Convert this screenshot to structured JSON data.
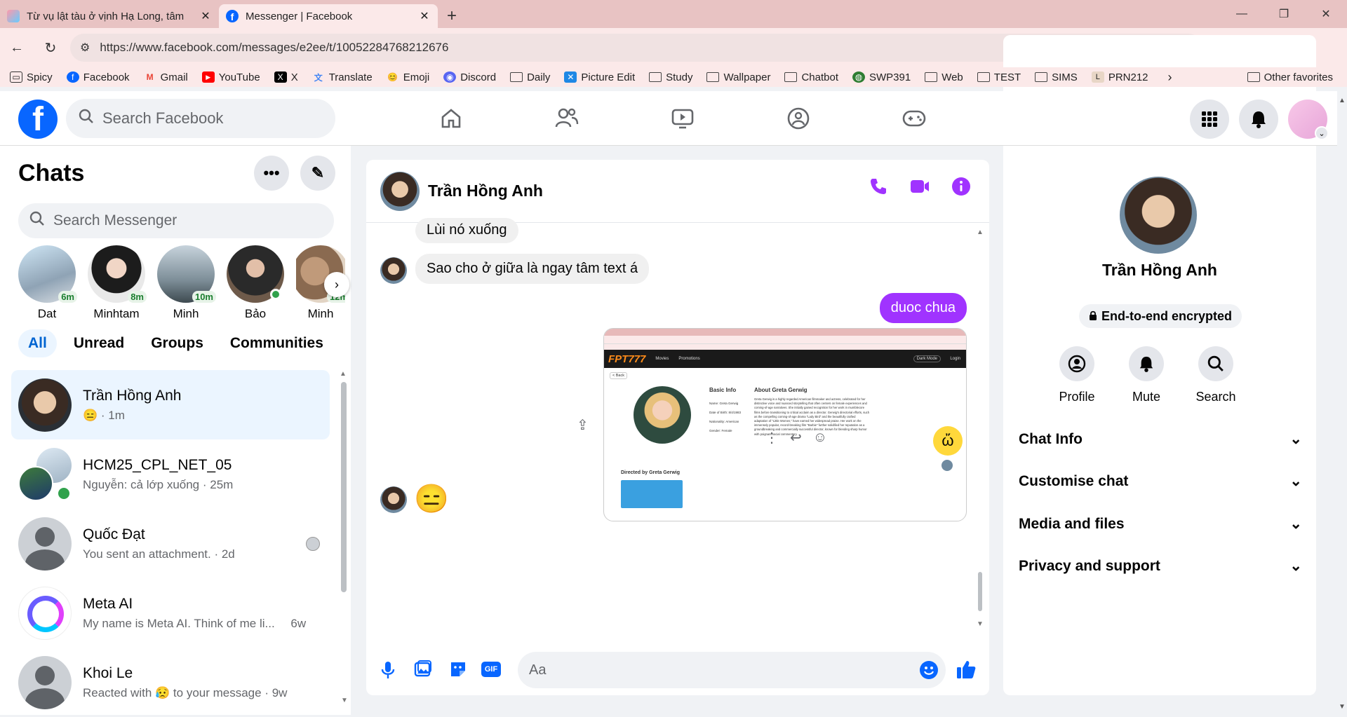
{
  "browser": {
    "tabs": [
      {
        "title": "Từ vụ lật tàu ở vịnh Hạ Long, tâm"
      },
      {
        "title": "Messenger | Facebook"
      }
    ],
    "url": "https://www.facebook.com/messages/e2ee/t/10052284768212676",
    "bookmarks": [
      "Spicy",
      "Facebook",
      "Gmail",
      "YouTube",
      "X",
      "Translate",
      "Emoji",
      "Discord",
      "Daily",
      "Picture Edit",
      "Study",
      "Wallpaper",
      "Chatbot",
      "SWP391",
      "Web",
      "TEST",
      "SIMS",
      "PRN212"
    ],
    "other_favorites": "Other favorites"
  },
  "facebook": {
    "search_placeholder": "Search Facebook",
    "chats_title": "Chats",
    "messenger_search_placeholder": "Search Messenger",
    "stories": [
      {
        "name": "Dat",
        "badge": "6m"
      },
      {
        "name": "Minhtam",
        "badge": "8m"
      },
      {
        "name": "Minh",
        "badge": "10m"
      },
      {
        "name": "Bảo",
        "badge": ""
      },
      {
        "name": "Minh",
        "badge": "12m"
      }
    ],
    "filters": [
      "All",
      "Unread",
      "Groups",
      "Communities"
    ],
    "chats": [
      {
        "name": "Trần Hồng Anh",
        "preview": "😑 · 1m"
      },
      {
        "name": "HCM25_CPL_NET_05",
        "preview": "Nguyễn: cả lớp xuống · 25m"
      },
      {
        "name": "Quốc Đạt",
        "preview": "You sent an attachment. · 2d"
      },
      {
        "name": "Meta AI",
        "preview": "My name is Meta AI. Think of me li...",
        "time": "6w"
      },
      {
        "name": "Khoi Le",
        "preview": "Reacted with",
        "emoji": "😥",
        "preview2": "to your message",
        "time": "9w"
      }
    ]
  },
  "conversation": {
    "contact_name": "Trần Hồng Anh",
    "messages": [
      {
        "text": "Lùi nó xuống",
        "from": "them"
      },
      {
        "text": "Sao cho ở giữa là ngay tâm text á",
        "from": "them"
      },
      {
        "text": "duoc chua",
        "from": "me"
      },
      {
        "text": "😑",
        "from": "them"
      }
    ],
    "screenshot": {
      "brand": "FPT777",
      "menu": [
        "Movies",
        "Promotions"
      ],
      "dark_mode": "Dark Mode",
      "login": "Login",
      "back": "< Back",
      "basic_info_title": "Basic Info",
      "name": "Name: Greta Gerwig",
      "dob": "Date of Birth: 8/4/1983",
      "nationality": "Nationality: American",
      "gender": "Gender: Female",
      "about_title": "About Greta Gerwig",
      "about_text": "Greta Gerwig is a highly regarded American filmmaker and actress, celebrated for her distinctive voice and nuanced storytelling that often centers on female experiences and coming-of-age narratives. She initially gained recognition for her work in mumblecore films before transitioning to critical acclaim as a director. Gerwig's directorial efforts, such as the compelling coming-of-age drama \"Lady Bird\" and the beautifully crafted adaptation of \"Little Women,\" have earned her widespread praise. Her work on the immensely popular, record-breaking film \"Barbie\" further solidified her reputation as a groundbreaking and commercially successful director, known for blending sharp humor with poignant social commentary.",
      "directed_by": "Directed by Greta Gerwig"
    },
    "composer_placeholder": "Aa"
  },
  "info_panel": {
    "name": "Trần Hồng Anh",
    "encrypted": "End-to-end encrypted",
    "actions": [
      "Profile",
      "Mute",
      "Search"
    ],
    "sections": [
      "Chat Info",
      "Customise chat",
      "Media and files",
      "Privacy and support"
    ]
  },
  "colors": {
    "accent": "#a033ff",
    "fb_blue": "#0866ff"
  }
}
